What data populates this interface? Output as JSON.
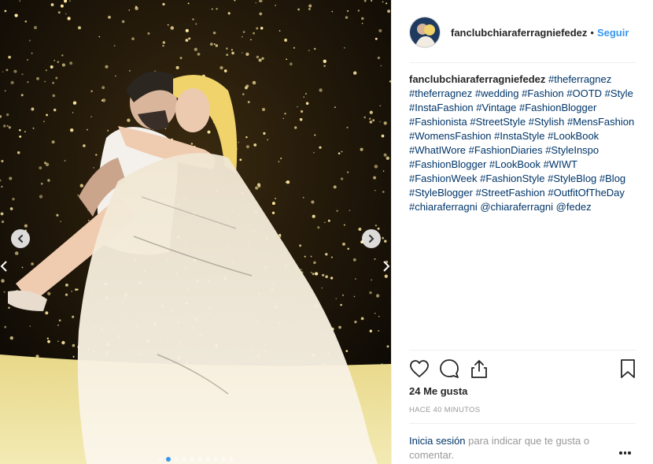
{
  "post": {
    "username": "fanclubchiaraferragniefedez",
    "follow_label": "Seguir",
    "separator": "•",
    "caption_parts": [
      "#theferragnez",
      "#theferragnez",
      "#wedding",
      "#Fashion",
      "#OOTD",
      "#Style",
      "#InstaFashion",
      "#Vintage",
      "#FashionBlogger",
      "#Fashionista",
      "#StreetStyle",
      "#Stylish",
      "#MensFashion",
      "#WomensFashion",
      "#InstaStyle",
      "#LookBook",
      "#WhatIWore",
      "#FashionDiaries",
      "#StyleInspo",
      "#FashionBlogger",
      "#LookBook",
      "#WIWT",
      "#FashionWeek",
      "#FashionStyle",
      "#StyleBlog",
      "#Blog",
      "#StyleBlogger",
      "#StreetFashion",
      "#OutfitOfTheDay",
      "#chiaraferragni",
      "@chiaraferragni",
      "@fedez"
    ],
    "likes": "24 Me gusta",
    "time": "HACE 40 MINUTOS",
    "login_link": "Inicia sesión",
    "login_text": " para indicar que te gusta o comentar."
  },
  "carousel": {
    "slide_count": 10,
    "active_index": 1,
    "accent": "#3897f0"
  },
  "icons": {
    "like": "heart-icon",
    "comment": "comment-icon",
    "share": "share-icon",
    "save": "bookmark-icon",
    "prev": "chevron-left-icon",
    "next": "chevron-right-icon",
    "more": "more-icon"
  }
}
